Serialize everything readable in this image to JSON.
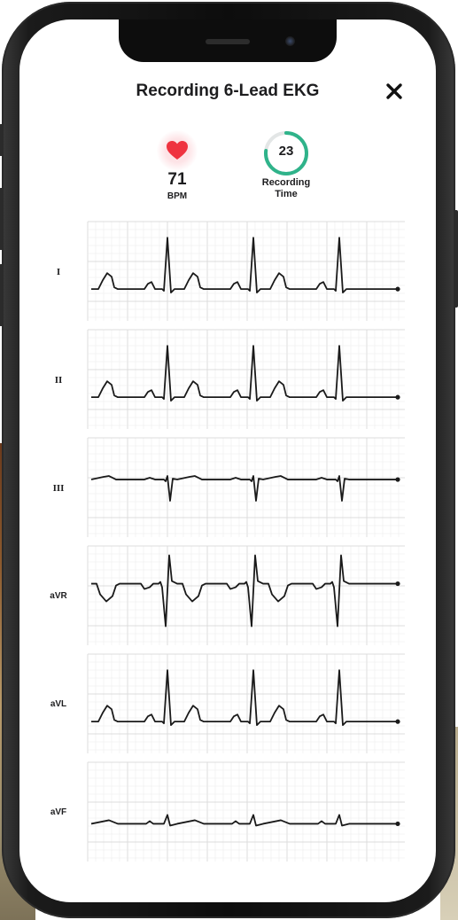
{
  "header": {
    "title": "Recording 6-Lead EKG",
    "close_icon": "close-icon"
  },
  "stats": {
    "heart_rate": {
      "icon": "heart-icon",
      "value": "71",
      "unit": "BPM",
      "color": "#ef3340"
    },
    "recording_time": {
      "value": "23",
      "label_line1": "Recording",
      "label_line2": "Time",
      "ring_color": "#2fb38a",
      "progress": 0.77
    }
  },
  "leads": [
    {
      "label": "I",
      "pattern": "positive"
    },
    {
      "label": "II",
      "pattern": "positive"
    },
    {
      "label": "III",
      "pattern": "flat-negative"
    },
    {
      "label": "aVR",
      "pattern": "inverted"
    },
    {
      "label": "aVL",
      "pattern": "positive"
    },
    {
      "label": "aVF",
      "pattern": "flat"
    }
  ],
  "colors": {
    "grid_minor": "#ececec",
    "grid_major": "#dcdcdc",
    "trace": "#1a1a1a"
  }
}
